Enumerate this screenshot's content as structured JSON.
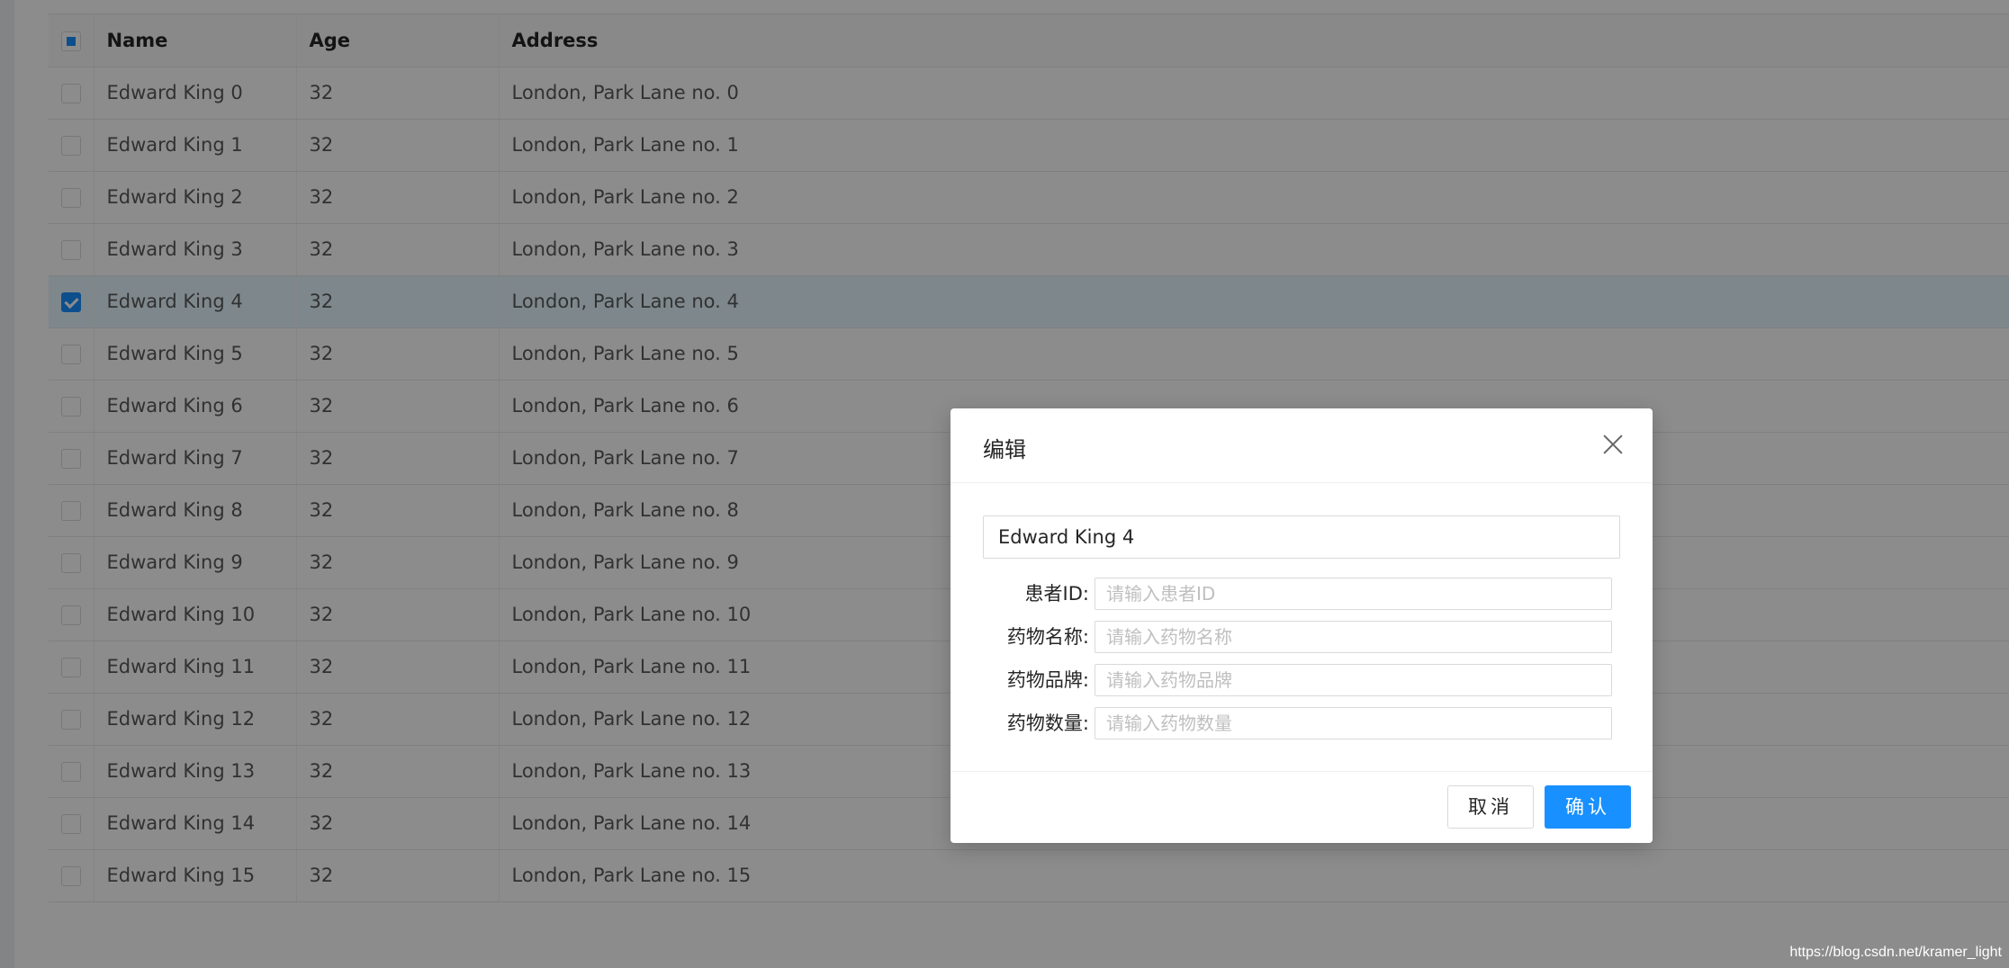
{
  "table": {
    "columns": [
      "Name",
      "Age",
      "Address"
    ],
    "header_checkbox_state": "indeterminate",
    "rows": [
      {
        "name": "Edward King 0",
        "age": "32",
        "address": "London, Park Lane no. 0",
        "selected": false
      },
      {
        "name": "Edward King 1",
        "age": "32",
        "address": "London, Park Lane no. 1",
        "selected": false
      },
      {
        "name": "Edward King 2",
        "age": "32",
        "address": "London, Park Lane no. 2",
        "selected": false
      },
      {
        "name": "Edward King 3",
        "age": "32",
        "address": "London, Park Lane no. 3",
        "selected": false
      },
      {
        "name": "Edward King 4",
        "age": "32",
        "address": "London, Park Lane no. 4",
        "selected": true
      },
      {
        "name": "Edward King 5",
        "age": "32",
        "address": "London, Park Lane no. 5",
        "selected": false
      },
      {
        "name": "Edward King 6",
        "age": "32",
        "address": "London, Park Lane no. 6",
        "selected": false
      },
      {
        "name": "Edward King 7",
        "age": "32",
        "address": "London, Park Lane no. 7",
        "selected": false
      },
      {
        "name": "Edward King 8",
        "age": "32",
        "address": "London, Park Lane no. 8",
        "selected": false
      },
      {
        "name": "Edward King 9",
        "age": "32",
        "address": "London, Park Lane no. 9",
        "selected": false
      },
      {
        "name": "Edward King 10",
        "age": "32",
        "address": "London, Park Lane no. 10",
        "selected": false
      },
      {
        "name": "Edward King 11",
        "age": "32",
        "address": "London, Park Lane no. 11",
        "selected": false
      },
      {
        "name": "Edward King 12",
        "age": "32",
        "address": "London, Park Lane no. 12",
        "selected": false
      },
      {
        "name": "Edward King 13",
        "age": "32",
        "address": "London, Park Lane no. 13",
        "selected": false
      },
      {
        "name": "Edward King 14",
        "age": "32",
        "address": "London, Park Lane no. 14",
        "selected": false
      },
      {
        "name": "Edward King 15",
        "age": "32",
        "address": "London, Park Lane no. 15",
        "selected": false
      }
    ]
  },
  "modal": {
    "title": "编辑",
    "close_icon": "close-icon",
    "name_value": "Edward King 4",
    "fields": [
      {
        "label": "患者ID:",
        "placeholder": "请输入患者ID",
        "value": ""
      },
      {
        "label": "药物名称:",
        "placeholder": "请输入药物名称",
        "value": ""
      },
      {
        "label": "药物品牌:",
        "placeholder": "请输入药物品牌",
        "value": ""
      },
      {
        "label": "药物数量:",
        "placeholder": "请输入药物数量",
        "value": ""
      }
    ],
    "cancel_label": "取消",
    "ok_label": "确认"
  },
  "watermark": "https://blog.csdn.net/kramer_light",
  "colors": {
    "primary": "#1890ff",
    "selected_row": "#e6f7ff",
    "mask": "rgba(0,0,0,0.45)"
  }
}
